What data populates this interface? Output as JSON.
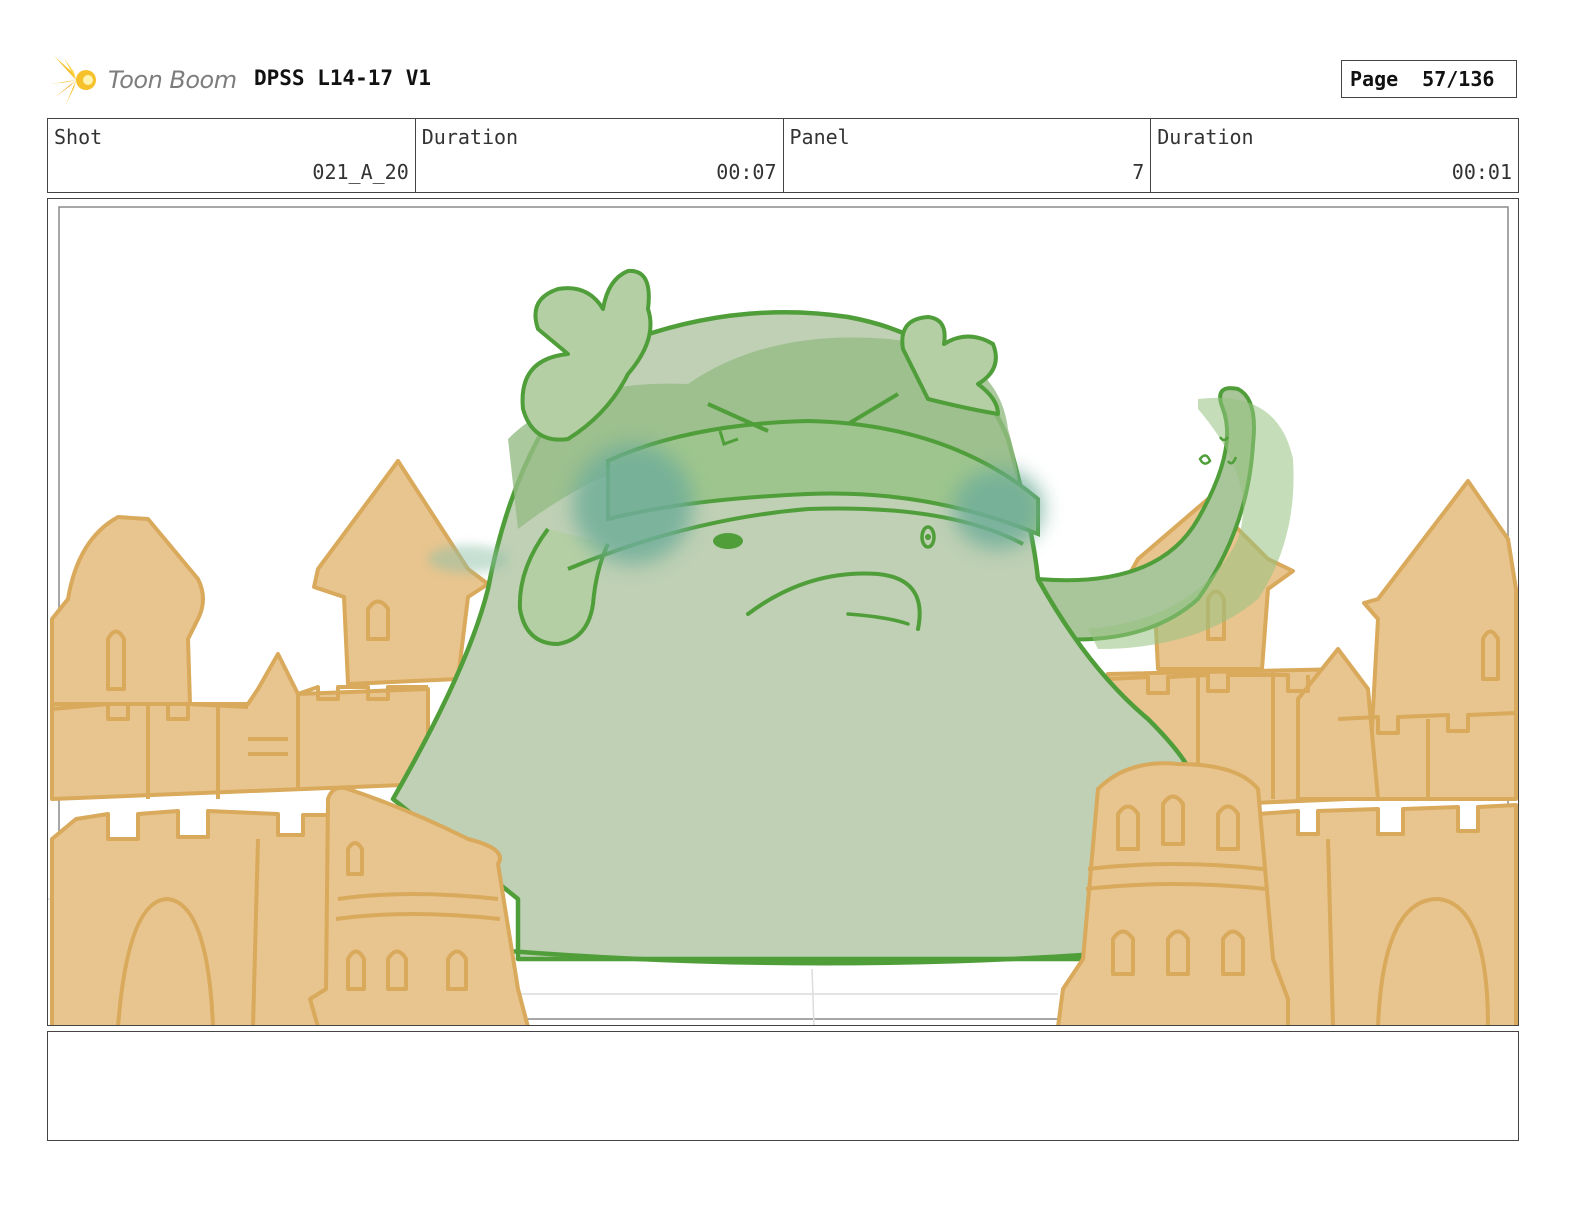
{
  "header": {
    "logo_text": "Toon Boom",
    "project_title": "DPSS L14-17 V1",
    "page_label": "Page",
    "page_value": "57/136"
  },
  "info": {
    "shot_label": "Shot",
    "shot_value": "021_A_20",
    "shot_duration_label": "Duration",
    "shot_duration_value": "00:07",
    "panel_label": "Panel",
    "panel_value": "7",
    "panel_duration_label": "Duration",
    "panel_duration_value": "00:01"
  },
  "colors": {
    "sand_fill": "#e8c48e",
    "sand_line": "#d9a95c",
    "blob_fill": "#bfd0b4",
    "blob_line": "#4f9e3a",
    "tear_blue": "#6fae9a"
  },
  "notes": {
    "text": ""
  }
}
